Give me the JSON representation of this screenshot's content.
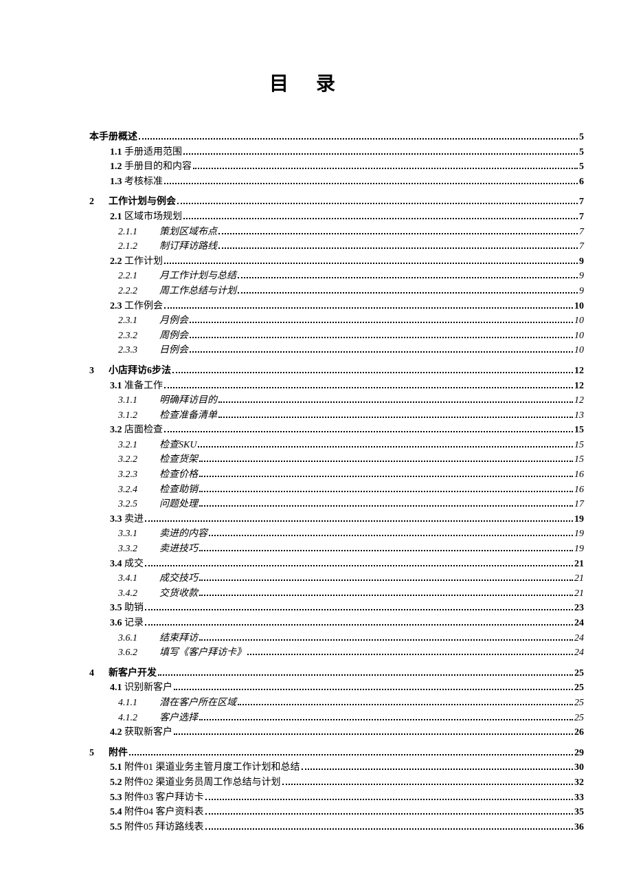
{
  "title": "目录",
  "entries": [
    {
      "level": 1,
      "class": "l1 first",
      "num": "",
      "label": "本手册概述",
      "page": "5",
      "bold": true
    },
    {
      "level": 2,
      "class": "l2",
      "num": "1.1",
      "label": " 手册适用范围",
      "page": "5"
    },
    {
      "level": 2,
      "class": "l2",
      "num": "1.2",
      "label": " 手册目的和内容",
      "page": "5"
    },
    {
      "level": 2,
      "class": "l2",
      "num": "1.3",
      "label": " 考核标准",
      "page": "6"
    },
    {
      "level": 1,
      "class": "l1",
      "num": "2",
      "label": "工作计划与例会",
      "page": "7",
      "bold": true
    },
    {
      "level": 2,
      "class": "l2",
      "num": "2.1",
      "label": " 区域市场规划",
      "page": "7"
    },
    {
      "level": 3,
      "class": "l3",
      "num": "2.1.1",
      "label": "策划区域布点",
      "page": "7"
    },
    {
      "level": 3,
      "class": "l3",
      "num": "2.1.2",
      "label": "制订拜访路线",
      "page": "7"
    },
    {
      "level": 2,
      "class": "l2",
      "num": "2.2",
      "label": " 工作计划",
      "page": "9"
    },
    {
      "level": 3,
      "class": "l3",
      "num": "2.2.1",
      "label": "月工作计划与总结",
      "page": "9"
    },
    {
      "level": 3,
      "class": "l3",
      "num": "2.2.2",
      "label": "周工作总结与计划",
      "page": "9"
    },
    {
      "level": 2,
      "class": "l2",
      "num": "2.3",
      "label": " 工作例会",
      "page": "10"
    },
    {
      "level": 3,
      "class": "l3",
      "num": "2.3.1",
      "label": "月例会",
      "page": "10"
    },
    {
      "level": 3,
      "class": "l3",
      "num": "2.3.2",
      "label": "周例会",
      "page": "10"
    },
    {
      "level": 3,
      "class": "l3",
      "num": "2.3.3",
      "label": "日例会",
      "page": "10"
    },
    {
      "level": 1,
      "class": "l1",
      "num": "3",
      "label": "小店拜访6步法",
      "page": "12",
      "bold": true
    },
    {
      "level": 2,
      "class": "l2",
      "num": "3.1",
      "label": " 准备工作",
      "page": "12"
    },
    {
      "level": 3,
      "class": "l3",
      "num": "3.1.1",
      "label": "明确拜访目的",
      "page": "12"
    },
    {
      "level": 3,
      "class": "l3",
      "num": "3.1.2",
      "label": "检查准备清单",
      "page": "13"
    },
    {
      "level": 2,
      "class": "l2",
      "num": "3.2",
      "label": " 店面检查",
      "page": "15"
    },
    {
      "level": 3,
      "class": "l3",
      "num": "3.2.1",
      "label": "检查SKU",
      "page": "15"
    },
    {
      "level": 3,
      "class": "l3",
      "num": "3.2.2",
      "label": "检查货架",
      "page": "15"
    },
    {
      "level": 3,
      "class": "l3",
      "num": "3.2.3",
      "label": "检查价格",
      "page": "16"
    },
    {
      "level": 3,
      "class": "l3",
      "num": "3.2.4",
      "label": "检查助销",
      "page": "16"
    },
    {
      "level": 3,
      "class": "l3",
      "num": "3.2.5",
      "label": "问题处理",
      "page": "17"
    },
    {
      "level": 2,
      "class": "l2",
      "num": "3.3",
      "label": " 卖进",
      "page": "19"
    },
    {
      "level": 3,
      "class": "l3",
      "num": "3.3.1",
      "label": "卖进的内容",
      "page": "19"
    },
    {
      "level": 3,
      "class": "l3",
      "num": "3.3.2",
      "label": "卖进技巧",
      "page": "19"
    },
    {
      "level": 2,
      "class": "l2",
      "num": "3.4",
      "label": " 成交",
      "page": "21"
    },
    {
      "level": 3,
      "class": "l3",
      "num": "3.4.1",
      "label": "成交技巧",
      "page": "21"
    },
    {
      "level": 3,
      "class": "l3",
      "num": "3.4.2",
      "label": "交货收款",
      "page": "21"
    },
    {
      "level": 2,
      "class": "l2",
      "num": "3.5",
      "label": " 助销",
      "page": "23"
    },
    {
      "level": 2,
      "class": "l2",
      "num": "3.6",
      "label": " 记录",
      "page": "24"
    },
    {
      "level": 3,
      "class": "l3",
      "num": "3.6.1",
      "label": "结束拜访",
      "page": "24"
    },
    {
      "level": 3,
      "class": "l3",
      "num": "3.6.2",
      "label": "填写《客户拜访卡》",
      "page": "24"
    },
    {
      "level": 1,
      "class": "l1",
      "num": "4",
      "label": "新客户开发",
      "page": "25",
      "bold": true
    },
    {
      "level": 2,
      "class": "l2",
      "num": "4.1",
      "label": " 识别新客户",
      "page": "25"
    },
    {
      "level": 3,
      "class": "l3",
      "num": "4.1.1",
      "label": "潜在客户所在区域",
      "page": "25"
    },
    {
      "level": 3,
      "class": "l3",
      "num": "4.1.2",
      "label": "客户选择",
      "page": "25"
    },
    {
      "level": 2,
      "class": "l2",
      "num": "4.2",
      "label": " 获取新客户",
      "page": "26"
    },
    {
      "level": 1,
      "class": "l1",
      "num": "5",
      "label": "附件",
      "page": "29",
      "bold": true
    },
    {
      "level": 2,
      "class": "l2",
      "num": "5.1",
      "label": " 附件01 渠道业务主管月度工作计划和总结",
      "page": "30"
    },
    {
      "level": 2,
      "class": "l2",
      "num": "5.2",
      "label": " 附件02 渠道业务员周工作总结与计划",
      "page": "32"
    },
    {
      "level": 2,
      "class": "l2",
      "num": "5.3",
      "label": " 附件03 客户拜访卡",
      "page": "33"
    },
    {
      "level": 2,
      "class": "l2",
      "num": "5.4",
      "label": " 附件04 客户资料表",
      "page": "35"
    },
    {
      "level": 2,
      "class": "l2",
      "num": "5.5",
      "label": " 附件05 拜访路线表",
      "page": "36"
    }
  ]
}
